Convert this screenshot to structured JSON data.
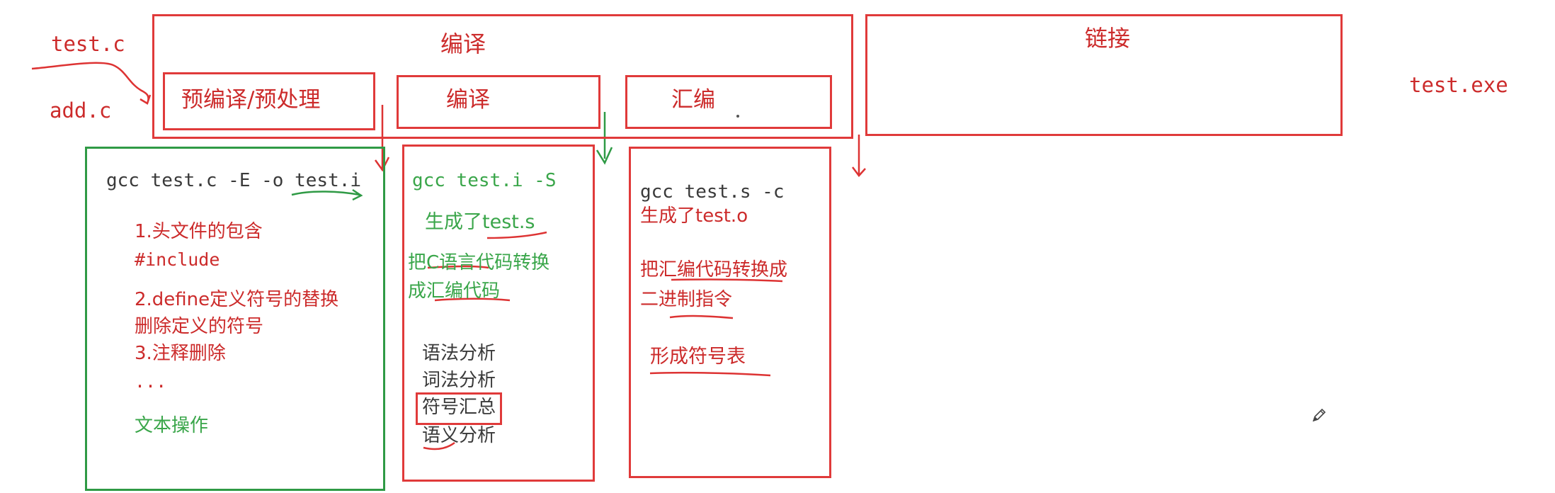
{
  "inputs": {
    "test_c": "test.c",
    "add_c": "add.c"
  },
  "output": {
    "test_exe": "test.exe"
  },
  "compile_group": {
    "title": "编译",
    "stages": {
      "preprocess": "预编译/预处理",
      "compile": "编译",
      "assemble": "汇编"
    }
  },
  "link": {
    "title": "链接"
  },
  "preprocess_detail": {
    "command": "gcc test.c -E -o test.i",
    "item1": "1.头文件的包含",
    "item1_sub": "#include",
    "item2": "2.define定义符号的替换",
    "item2_sub": "删除定义的符号",
    "item3": "3.注释删除",
    "ellipsis": "...",
    "summary": "文本操作"
  },
  "compile_detail": {
    "command": "gcc test.i -S",
    "generated": "生成了test.s",
    "desc_line1": "把C语言代码转换",
    "desc_line2": "成汇编代码",
    "steps": [
      "语法分析",
      "词法分析",
      "符号汇总",
      "语义分析"
    ]
  },
  "assemble_detail": {
    "command": "gcc test.s -c",
    "generated": "生成了test.o",
    "desc_line1": "把汇编代码转换成",
    "desc_line2": "二进制指令",
    "symbol_table": "形成符号表"
  },
  "icons": {
    "pencil": "pencil-icon"
  },
  "colors": {
    "red": "#e03a3a",
    "green": "#2f9a45",
    "text": "#3a3a3a"
  }
}
